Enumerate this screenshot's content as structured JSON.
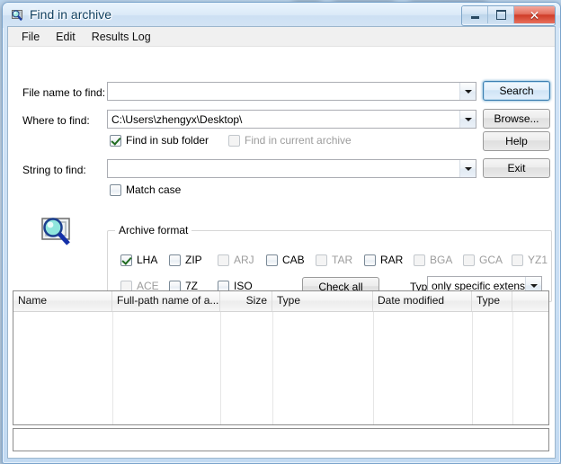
{
  "window": {
    "title": "Find in archive",
    "icon": "magnifier-document-icon",
    "buttons": {
      "minimize": "minimize-icon",
      "maximize": "maximize-icon",
      "close": "✕"
    }
  },
  "menu": {
    "items": [
      {
        "label": "File"
      },
      {
        "label": "Edit"
      },
      {
        "label": "Results Log"
      }
    ]
  },
  "form": {
    "file_name_label": "File name to find:",
    "file_name_value": "",
    "where_label": "Where to find:",
    "where_value": "C:\\Users\\zhengyx\\Desktop\\",
    "string_label": "String to find:",
    "string_value": "",
    "find_sub_folder": {
      "label": "Find in sub folder",
      "checked": true,
      "enabled": true
    },
    "find_current_archive": {
      "label": "Find in current archive",
      "checked": false,
      "enabled": false
    },
    "match_case": {
      "label": "Match case",
      "checked": false,
      "enabled": true
    },
    "search_icon": "magnifier-document-icon"
  },
  "buttons": {
    "search": "Search",
    "browse": "Browse...",
    "help": "Help",
    "exit": "Exit",
    "check_all": "Check all"
  },
  "archive_format": {
    "title": "Archive format",
    "row1": [
      {
        "label": "LHA",
        "checked": true,
        "enabled": true
      },
      {
        "label": "ZIP",
        "checked": false,
        "enabled": true
      },
      {
        "label": "ARJ",
        "checked": false,
        "enabled": false
      },
      {
        "label": "CAB",
        "checked": false,
        "enabled": true
      },
      {
        "label": "TAR",
        "checked": false,
        "enabled": false
      },
      {
        "label": "RAR",
        "checked": false,
        "enabled": true
      },
      {
        "label": "BGA",
        "checked": false,
        "enabled": false
      },
      {
        "label": "GCA",
        "checked": false,
        "enabled": false
      },
      {
        "label": "YZ1",
        "checked": false,
        "enabled": false
      }
    ],
    "row2": [
      {
        "label": "ACE",
        "checked": false,
        "enabled": false
      },
      {
        "label": "7Z",
        "checked": false,
        "enabled": true
      },
      {
        "label": "ISO",
        "checked": false,
        "enabled": true
      }
    ],
    "types_label": "Types:",
    "types_value": "only specific extensio"
  },
  "results": {
    "columns": [
      {
        "label": "Name",
        "align": "left"
      },
      {
        "label": "Full-path name of a...",
        "align": "left"
      },
      {
        "label": "Size",
        "align": "right"
      },
      {
        "label": "Type",
        "align": "left"
      },
      {
        "label": "Date modified",
        "align": "left"
      },
      {
        "label": "Type",
        "align": "left"
      },
      {
        "label": "",
        "align": "left"
      }
    ],
    "rows": []
  },
  "colors": {
    "accent": "#3c7fb1",
    "title_text": "#0b3c5d",
    "close_button": "#cf3c28",
    "frame": "#7ba4cc"
  }
}
